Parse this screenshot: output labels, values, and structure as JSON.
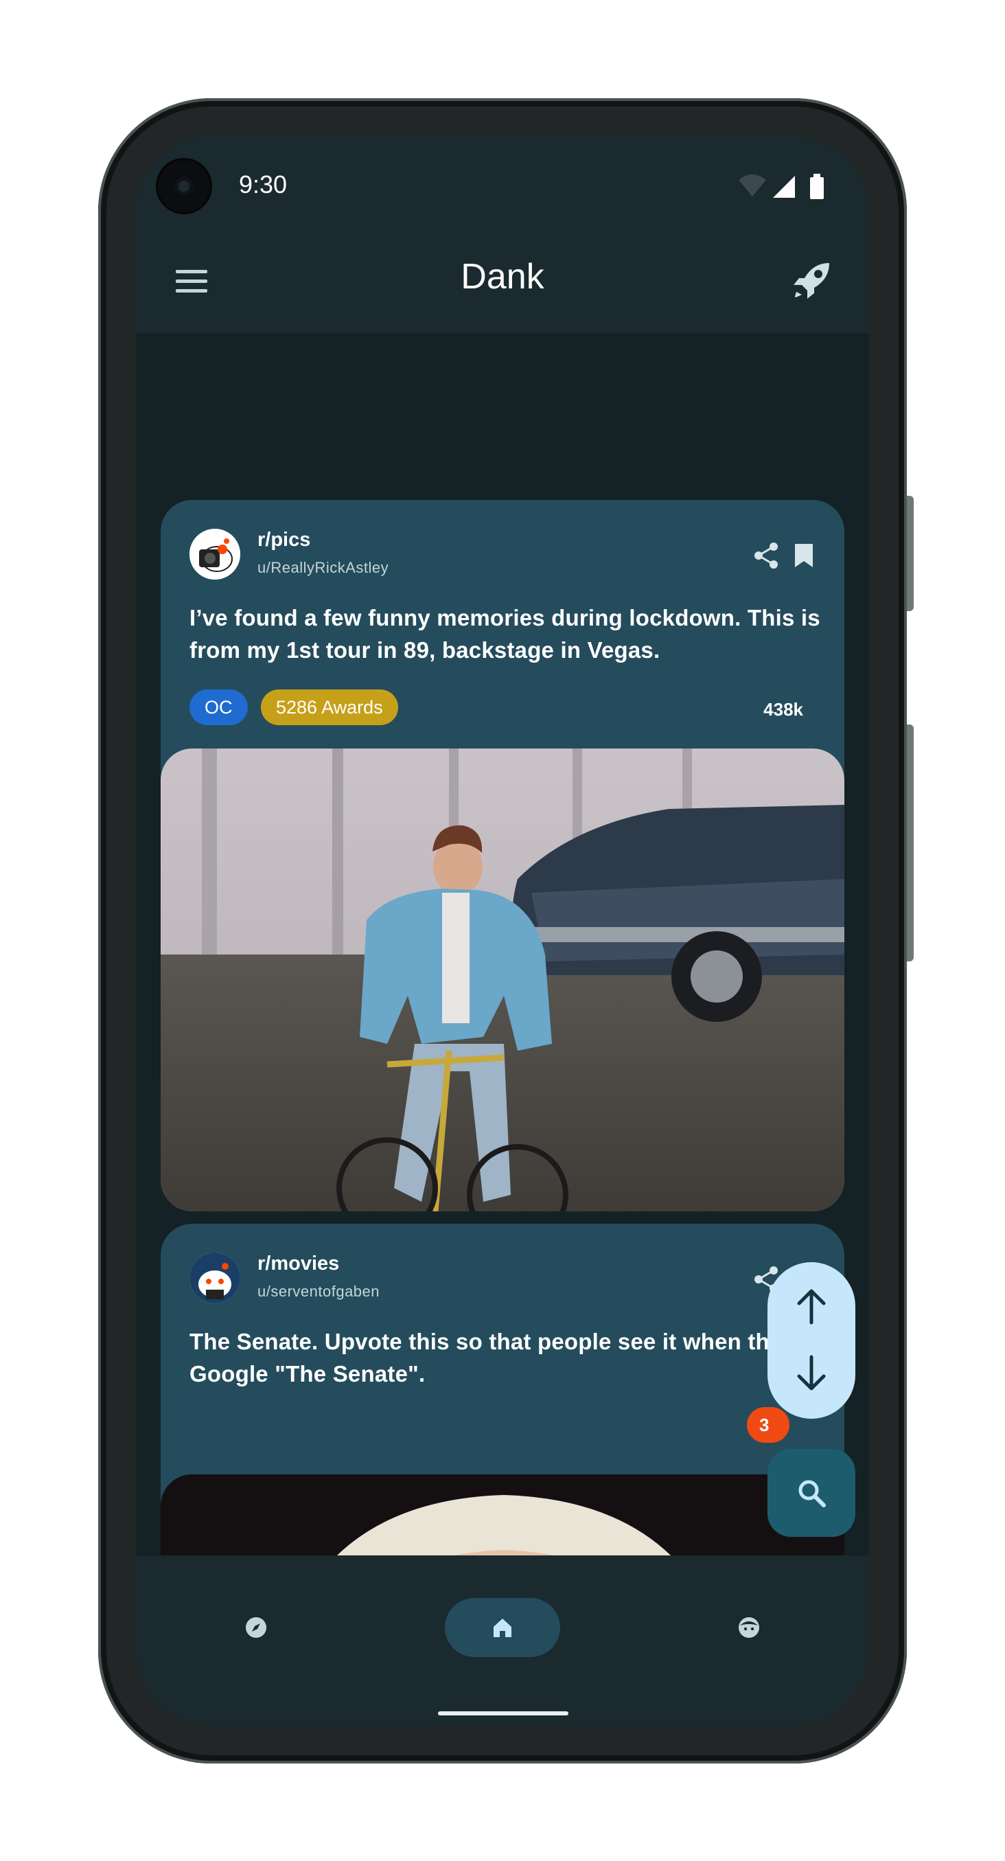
{
  "status_bar": {
    "time": "9:30"
  },
  "app_bar": {
    "title": "Dank"
  },
  "posts": [
    {
      "subreddit": "r/pics",
      "author": "u/ReallyRickAstley",
      "title": "I’ve found a few funny memories during lockdown. This is from my 1st tour in 89, backstage in Vegas.",
      "flair": "OC",
      "awards": "5286 Awards",
      "score": "438k",
      "bookmarked": true,
      "flair_color": "#1f6bd0",
      "awards_color": "#c7a01a"
    },
    {
      "subreddit": "r/movies",
      "author": "u/serventofgaben",
      "title": "The Senate. Upvote this so that people see it when they Google \"The Senate\".",
      "score_partial": "3",
      "bookmarked": false,
      "score_color": "#f04a12"
    }
  ],
  "bottom_nav": [
    {
      "id": "explore",
      "icon": "compass-icon",
      "selected": false
    },
    {
      "id": "home",
      "icon": "home-icon",
      "selected": true
    },
    {
      "id": "profile",
      "icon": "face-icon",
      "selected": false
    }
  ],
  "colors": {
    "background": "#142125",
    "bar": "#1b2a2e",
    "card": "#244c5c",
    "vote_fab": "#c6e7fb",
    "search_fab": "#1d5c6c"
  }
}
